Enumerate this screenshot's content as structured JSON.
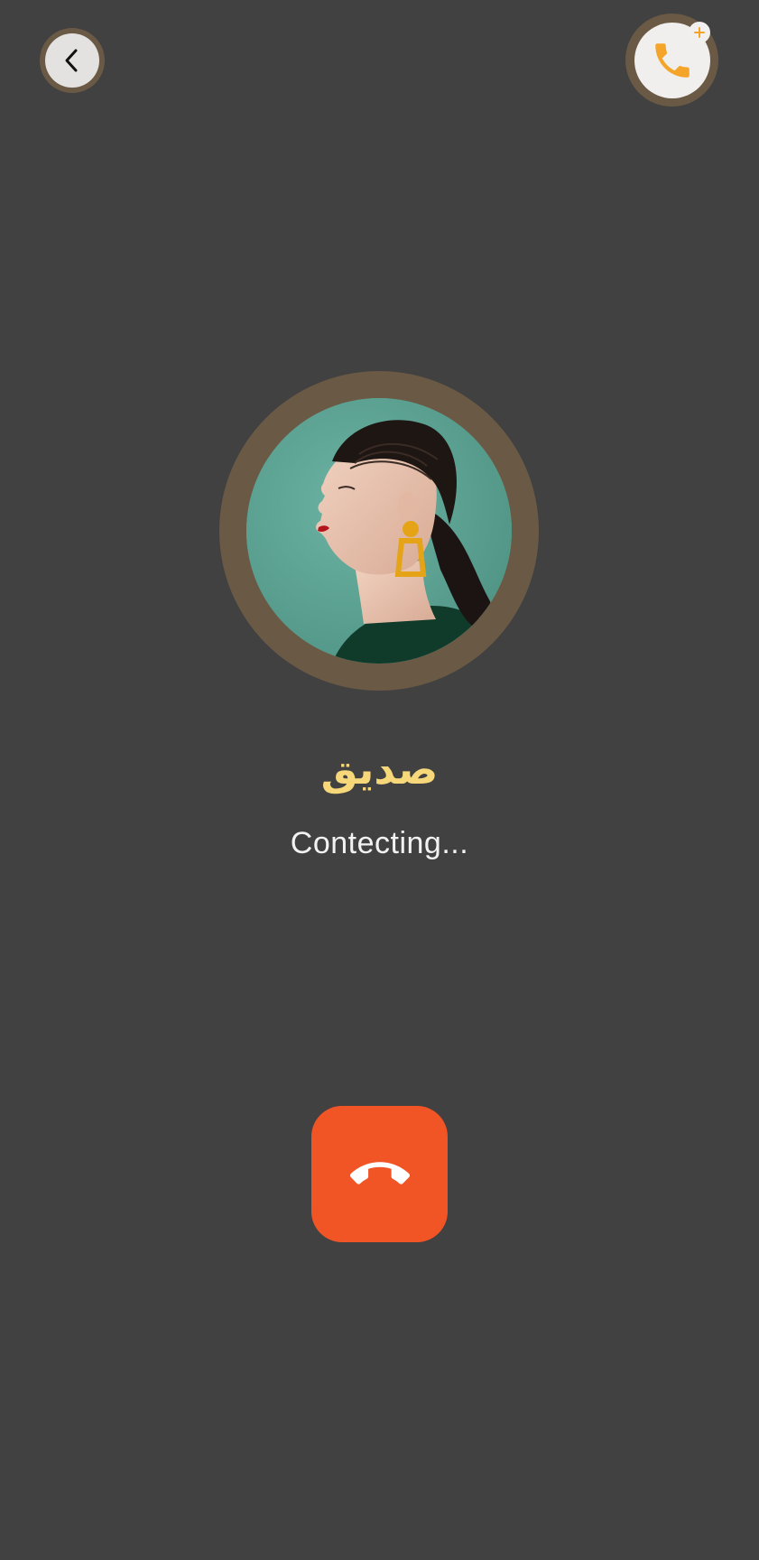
{
  "header": {
    "back_icon": "chevron-left-icon",
    "add_call_icon": "phone-icon",
    "add_badge_icon": "plus-icon"
  },
  "contact": {
    "name": "صديق",
    "avatar": "woman-profile-photo"
  },
  "call": {
    "status": "Contecting...",
    "end_call_icon": "phone-hangup-icon"
  },
  "colors": {
    "background": "#414141",
    "ring": "#6a5a45",
    "accent_orange": "#f4a429",
    "name_yellow": "#f6d77a",
    "end_call_red": "#f15526"
  }
}
